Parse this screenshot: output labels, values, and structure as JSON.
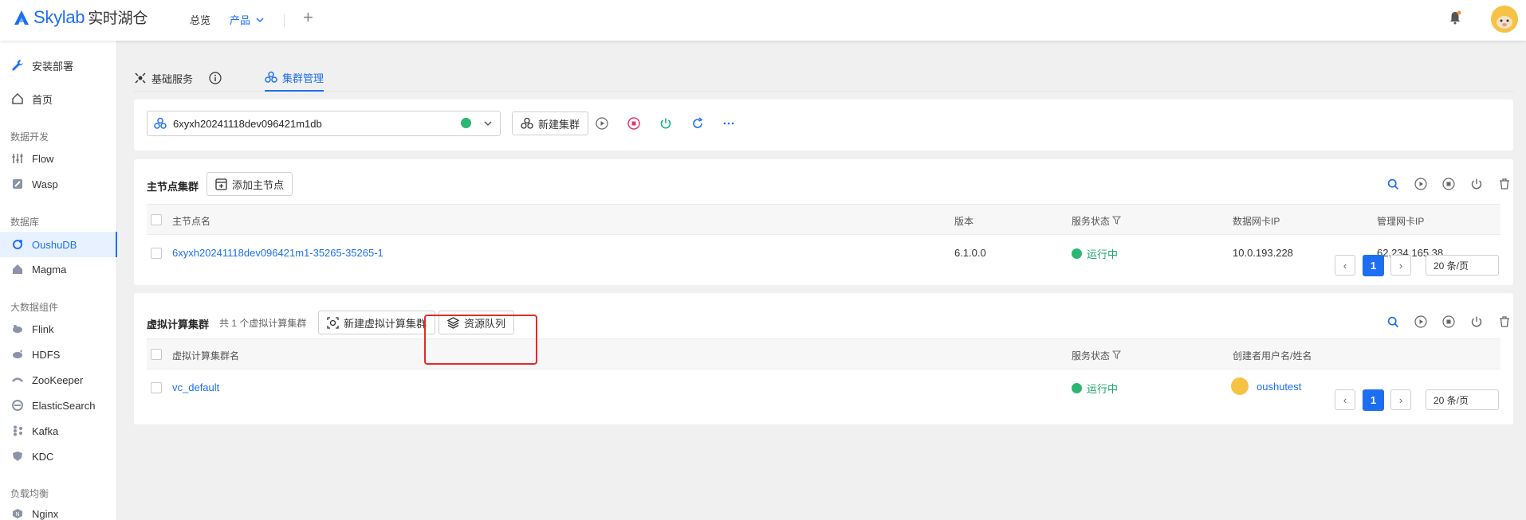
{
  "app": {
    "logo_brand": "Skylab",
    "logo_sub": "实时湖仓",
    "nav": [
      {
        "label": "总览"
      },
      {
        "label": "产品"
      }
    ]
  },
  "sidebar": {
    "top_items": [
      {
        "label": "安装部署",
        "icon": "wrench-icon"
      },
      {
        "label": "首页",
        "icon": "home-icon"
      }
    ],
    "groups": [
      {
        "title": "数据开发",
        "items": [
          {
            "label": "Flow",
            "icon": "sliders-icon"
          },
          {
            "label": "Wasp",
            "icon": "edit-icon"
          }
        ]
      },
      {
        "title": "数据库",
        "items": [
          {
            "label": "OushuDB",
            "icon": "oushudb-icon"
          },
          {
            "label": "Magma",
            "icon": "home-icon"
          }
        ]
      },
      {
        "title": "大数据组件",
        "items": [
          {
            "label": "Flink",
            "icon": "flink-icon"
          },
          {
            "label": "HDFS",
            "icon": "hdfs-icon"
          },
          {
            "label": "ZooKeeper",
            "icon": "zookeeper-icon"
          },
          {
            "label": "ElasticSearch",
            "icon": "elastic-icon"
          },
          {
            "label": "Kafka",
            "icon": "kafka-icon"
          },
          {
            "label": "KDC",
            "icon": "shield-icon"
          }
        ]
      },
      {
        "title": "负载均衡",
        "items": [
          {
            "label": "Nginx",
            "icon": "nginx-icon"
          }
        ]
      }
    ],
    "active": "OushuDB"
  },
  "tabs": [
    {
      "label": "基础服务"
    },
    {
      "label": "集群管理"
    }
  ],
  "cluster": {
    "selected": "6xyxh20241118dev096421m1db",
    "new_cluster_label": "新建集群"
  },
  "master": {
    "title": "主节点集群",
    "add_label": "添加主节点",
    "columns": [
      "主节点名",
      "版本",
      "服务状态",
      "数据网卡IP",
      "管理网卡IP"
    ],
    "rows": [
      {
        "name": "6xyxh20241118dev096421m1-35265-35265-1",
        "version": "6.1.0.0",
        "status": "运行中",
        "data_ip": "10.0.193.228",
        "mgmt_ip": "62.234.165.38"
      }
    ],
    "page": "1",
    "page_size": "20 条/页"
  },
  "virtual": {
    "title": "虚拟计算集群",
    "count_text": "共 1 个虚拟计算集群",
    "new_label": "新建虚拟计算集群",
    "queue_label": "资源队列",
    "columns": [
      "虚拟计算集群名",
      "服务状态",
      "创建者用户名/姓名"
    ],
    "rows": [
      {
        "name": "vc_default",
        "status": "运行中",
        "creator": "oushutest"
      }
    ],
    "page": "1",
    "page_size": "20 条/页"
  },
  "colors": {
    "accent": "#1d6ff2",
    "running": "#19a56a",
    "highlight": "#e42a2a"
  }
}
